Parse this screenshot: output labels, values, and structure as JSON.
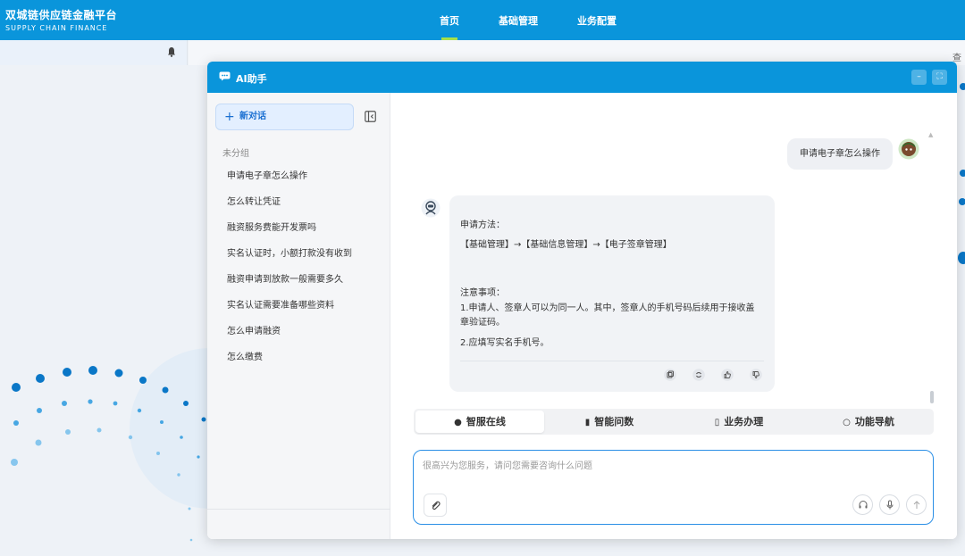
{
  "app": {
    "brand_cn": "双城链供应链金融平台",
    "brand_en": "SUPPLY CHAIN FINANCE",
    "nav": [
      {
        "label": "首页",
        "active": true
      },
      {
        "label": "基础管理",
        "active": false
      },
      {
        "label": "业务配置",
        "active": false
      }
    ],
    "peek_text": "查",
    "accent_color": "#0a95db"
  },
  "dialog": {
    "title": "AI助手",
    "minimize_label": "–",
    "expand_label": "⛶"
  },
  "sidebar": {
    "new_chat_label": "新对话",
    "group_label": "未分组",
    "history": [
      "申请电子章怎么操作",
      "怎么转让凭证",
      "融资服务费能开发票吗",
      "实名认证时，小额打款没有收到",
      "融资申请到放款一般需要多久",
      "实名认证需要准备哪些资料",
      "怎么申请融资",
      "怎么缴费"
    ]
  },
  "chat": {
    "user_message": "申请电子章怎么操作",
    "bot_lines": [
      "申请方法：",
      "【基础管理】→【基础信息管理】→【电子签章管理】",
      "注意事项：",
      "1.申请人、签章人可以为同一人。其中，签章人的手机号码后续用于接收盖",
      "章验证码。",
      "2.应填写实名手机号。"
    ],
    "actions": [
      "copy-icon",
      "refresh-icon",
      "thumbs-up-icon",
      "thumbs-down-icon"
    ]
  },
  "tabs": [
    {
      "label": "智服在线",
      "icon": "question-circle-icon",
      "glyph": "❓",
      "active": true
    },
    {
      "label": "智能问数",
      "icon": "bar-chart-icon",
      "glyph": "▮",
      "active": false
    },
    {
      "label": "业务办理",
      "icon": "document-icon",
      "glyph": "🗎",
      "active": false
    },
    {
      "label": "功能导航",
      "icon": "search-icon",
      "glyph": "⌕",
      "active": false
    }
  ],
  "composer": {
    "placeholder": "很高兴为您服务，请问您需要咨询什么问题",
    "value": ""
  }
}
